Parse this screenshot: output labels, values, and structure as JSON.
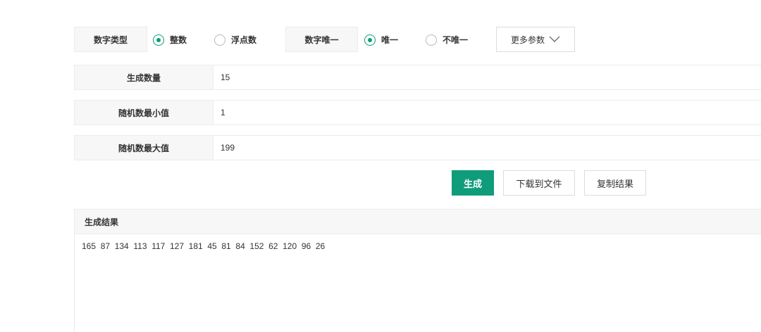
{
  "options": {
    "number_type_label": "数字类型",
    "integer_label": "整数",
    "float_label": "浮点数",
    "unique_label": "数字唯一",
    "unique_yes_label": "唯一",
    "unique_no_label": "不唯一",
    "more_params_label": "更多参数",
    "number_type_selected": "整数",
    "unique_selected": "唯一"
  },
  "form": {
    "count_label": "生成数量",
    "count_value": "15",
    "min_label": "随机数最小值",
    "min_value": "1",
    "max_label": "随机数最大值",
    "max_value": "199"
  },
  "actions": {
    "generate_label": "生成",
    "download_label": "下载到文件",
    "copy_label": "复制结果"
  },
  "result": {
    "title": "生成结果",
    "text": "165  87  134  113  117  127  181  45  81  84  152  62  120  96  26"
  },
  "colors": {
    "accent": "#0f9c7a"
  }
}
